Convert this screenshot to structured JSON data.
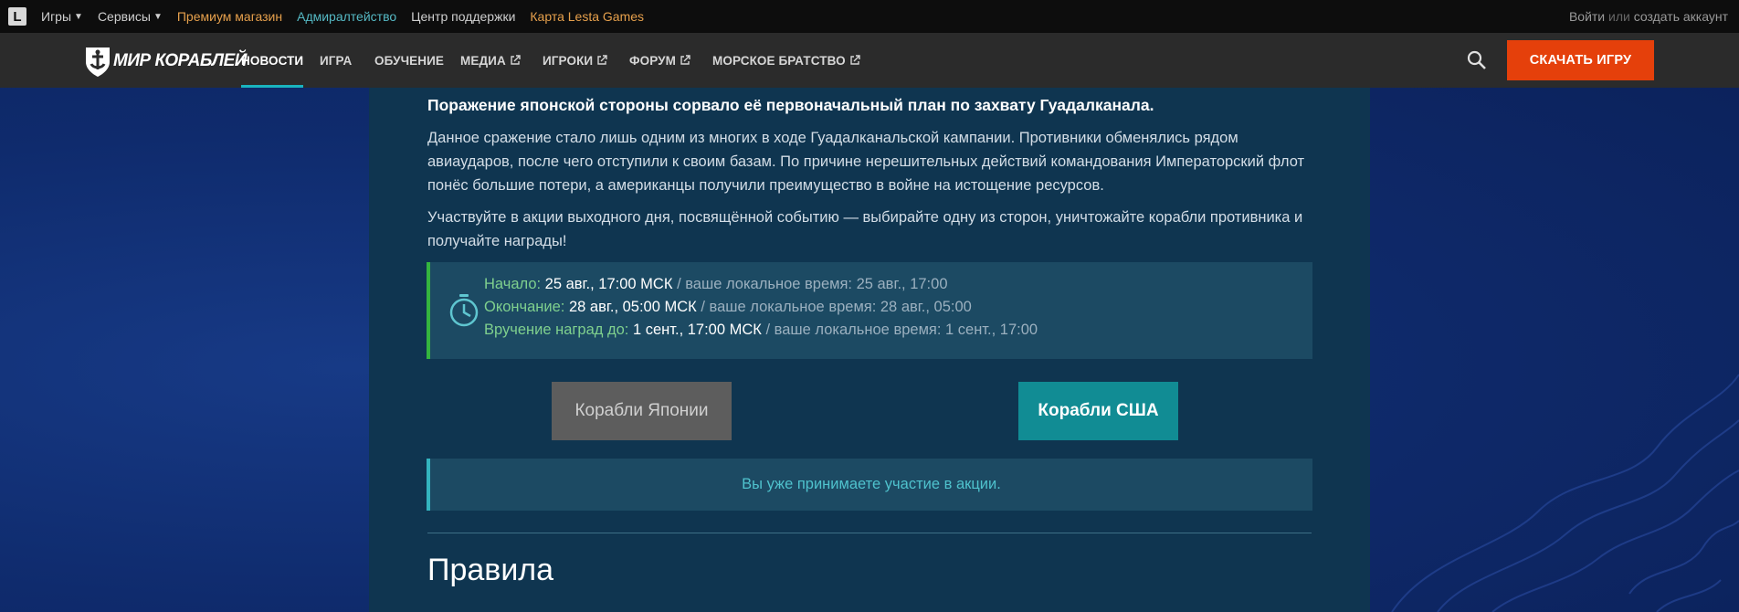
{
  "topbar": {
    "logo_letter": "L",
    "items": [
      {
        "label": "Игры",
        "dropdown": true,
        "color": "#cfcfcf"
      },
      {
        "label": "Сервисы",
        "dropdown": true,
        "color": "#cfcfcf"
      },
      {
        "label": "Премиум магазин",
        "dropdown": false,
        "color": "#e6a04c"
      },
      {
        "label": "Адмиралтейство",
        "dropdown": false,
        "color": "#55b9c4"
      },
      {
        "label": "Центр поддержки",
        "dropdown": false,
        "color": "#cfcfcf"
      },
      {
        "label": "Карта Lesta Games",
        "dropdown": false,
        "color": "#e6a04c"
      }
    ],
    "login": "Войти",
    "or": "или",
    "register": "создать аккаунт"
  },
  "nav": {
    "logo_text": "МИР КОРАБЛЕЙ",
    "items": [
      {
        "label": "НОВОСТИ",
        "active": true,
        "external": false
      },
      {
        "label": "ИГРА",
        "active": false,
        "external": false
      },
      {
        "label": "ОБУЧЕНИЕ",
        "active": false,
        "external": false
      },
      {
        "label": "МЕДИА",
        "active": false,
        "external": true
      },
      {
        "label": "ИГРОКИ",
        "active": false,
        "external": true
      },
      {
        "label": "ФОРУМ",
        "active": false,
        "external": true
      },
      {
        "label": "МОРСКОЕ БРАТСТВО",
        "active": false,
        "external": true
      }
    ],
    "download_label": "СКАЧАТЬ ИГРУ",
    "accent": "#1ab4bf",
    "download_color": "#e5400b"
  },
  "article": {
    "bold_line": "Поражение японской стороны сорвало её первоначальный план по захвату Гуадалканала.",
    "paragraph_1": "Данное сражение стало лишь одним из многих в ходе Гуадалканальской кампании. Противники обменялись рядом авиаударов, после чего отступили к своим базам. По причине нерешительных действий командования Императорский флот понёс большие потери, а американцы получили преимущество в войне на истощение ресурсов.",
    "paragraph_2": "Участвуйте в акции выходного дня, посвящённой событию — выбирайте одну из сторон, уничтожайте корабли противника и получайте награды!",
    "dates": [
      {
        "label": "Начало:",
        "value": "25 авг., 17:00 МСК",
        "local": "/ ваше локальное время: 25 авг., 17:00"
      },
      {
        "label": "Окончание:",
        "value": "28 авг., 05:00 МСК",
        "local": "/ ваше локальное время: 28 авг., 05:00"
      },
      {
        "label": "Вручение наград до:",
        "value": "1 сент., 17:00 МСК",
        "local": "/ ваше локальное время: 1 сент., 17:00"
      }
    ],
    "btn_japan": "Корабли Японии",
    "btn_usa": "Корабли США",
    "status": "Вы уже принимаете участие в акции.",
    "section_title": "Правила"
  }
}
